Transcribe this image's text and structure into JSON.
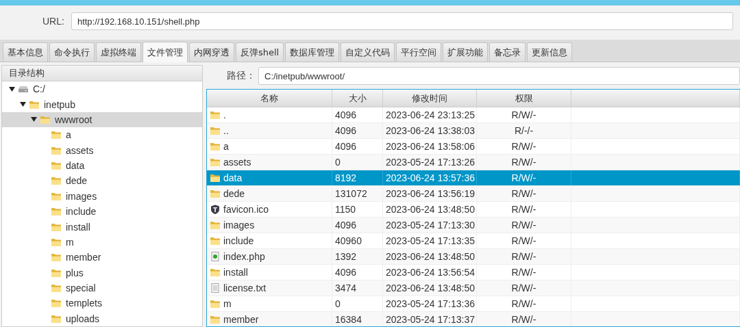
{
  "url_bar": {
    "label": "URL:",
    "value": "http://192.168.10.151/shell.php"
  },
  "tabs": [
    {
      "label": "基本信息",
      "selected": false
    },
    {
      "label": "命令执行",
      "selected": false
    },
    {
      "label": "虚拟终端",
      "selected": false
    },
    {
      "label": "文件管理",
      "selected": true
    },
    {
      "label": "内网穿透",
      "selected": false
    },
    {
      "label": "反弹shell",
      "selected": false
    },
    {
      "label": "数据库管理",
      "selected": false
    },
    {
      "label": "自定义代码",
      "selected": false
    },
    {
      "label": "平行空间",
      "selected": false
    },
    {
      "label": "扩展功能",
      "selected": false
    },
    {
      "label": "备忘录",
      "selected": false
    },
    {
      "label": "更新信息",
      "selected": false
    }
  ],
  "tree": {
    "title": "目录结构",
    "items": [
      {
        "label": "C:/",
        "kind": "drive",
        "expanded": true,
        "selected": false,
        "children": [
          {
            "label": "inetpub",
            "kind": "folder",
            "expanded": true,
            "selected": false,
            "children": [
              {
                "label": "wwwroot",
                "kind": "folder",
                "expanded": true,
                "selected": true,
                "children": [
                  {
                    "label": "a",
                    "kind": "folder",
                    "selected": false
                  },
                  {
                    "label": "assets",
                    "kind": "folder",
                    "selected": false
                  },
                  {
                    "label": "data",
                    "kind": "folder",
                    "selected": false
                  },
                  {
                    "label": "dede",
                    "kind": "folder",
                    "selected": false
                  },
                  {
                    "label": "images",
                    "kind": "folder",
                    "selected": false
                  },
                  {
                    "label": "include",
                    "kind": "folder",
                    "selected": false
                  },
                  {
                    "label": "install",
                    "kind": "folder",
                    "selected": false
                  },
                  {
                    "label": "m",
                    "kind": "folder",
                    "selected": false
                  },
                  {
                    "label": "member",
                    "kind": "folder",
                    "selected": false
                  },
                  {
                    "label": "plus",
                    "kind": "folder",
                    "selected": false
                  },
                  {
                    "label": "special",
                    "kind": "folder",
                    "selected": false
                  },
                  {
                    "label": "templets",
                    "kind": "folder",
                    "selected": false
                  },
                  {
                    "label": "uploads",
                    "kind": "folder",
                    "selected": false
                  }
                ]
              }
            ]
          }
        ]
      }
    ]
  },
  "path_bar": {
    "label": "路径：",
    "value": "C:/inetpub/wwwroot/"
  },
  "table": {
    "columns": [
      "名称",
      "大小",
      "修改时间",
      "权限"
    ],
    "rows": [
      {
        "kind": "folder",
        "name": ".",
        "size": "4096",
        "modified": "2023-06-24 23:13:25",
        "permission": "R/W/-",
        "selected": false
      },
      {
        "kind": "folder",
        "name": "..",
        "size": "4096",
        "modified": "2023-06-24 13:38:03",
        "permission": "R/-/-",
        "selected": false
      },
      {
        "kind": "folder",
        "name": "a",
        "size": "4096",
        "modified": "2023-06-24 13:58:06",
        "permission": "R/W/-",
        "selected": false
      },
      {
        "kind": "folder",
        "name": "assets",
        "size": "0",
        "modified": "2023-05-24 17:13:26",
        "permission": "R/W/-",
        "selected": false
      },
      {
        "kind": "folder",
        "name": "data",
        "size": "8192",
        "modified": "2023-06-24 13:57:36",
        "permission": "R/W/-",
        "selected": true
      },
      {
        "kind": "folder",
        "name": "dede",
        "size": "131072",
        "modified": "2023-06-24 13:56:19",
        "permission": "R/W/-",
        "selected": false
      },
      {
        "kind": "shield",
        "name": "favicon.ico",
        "size": "1150",
        "modified": "2023-06-24 13:48:50",
        "permission": "R/W/-",
        "selected": false
      },
      {
        "kind": "folder",
        "name": "images",
        "size": "4096",
        "modified": "2023-05-24 17:13:30",
        "permission": "R/W/-",
        "selected": false
      },
      {
        "kind": "folder",
        "name": "include",
        "size": "40960",
        "modified": "2023-05-24 17:13:35",
        "permission": "R/W/-",
        "selected": false
      },
      {
        "kind": "script",
        "name": "index.php",
        "size": "1392",
        "modified": "2023-06-24 13:48:50",
        "permission": "R/W/-",
        "selected": false
      },
      {
        "kind": "folder",
        "name": "install",
        "size": "4096",
        "modified": "2023-06-24 13:56:54",
        "permission": "R/W/-",
        "selected": false
      },
      {
        "kind": "text",
        "name": "license.txt",
        "size": "3474",
        "modified": "2023-06-24 13:48:50",
        "permission": "R/W/-",
        "selected": false
      },
      {
        "kind": "folder",
        "name": "m",
        "size": "0",
        "modified": "2023-05-24 17:13:36",
        "permission": "R/W/-",
        "selected": false
      },
      {
        "kind": "folder",
        "name": "member",
        "size": "16384",
        "modified": "2023-05-24 17:13:37",
        "permission": "R/W/-",
        "selected": false
      }
    ]
  }
}
